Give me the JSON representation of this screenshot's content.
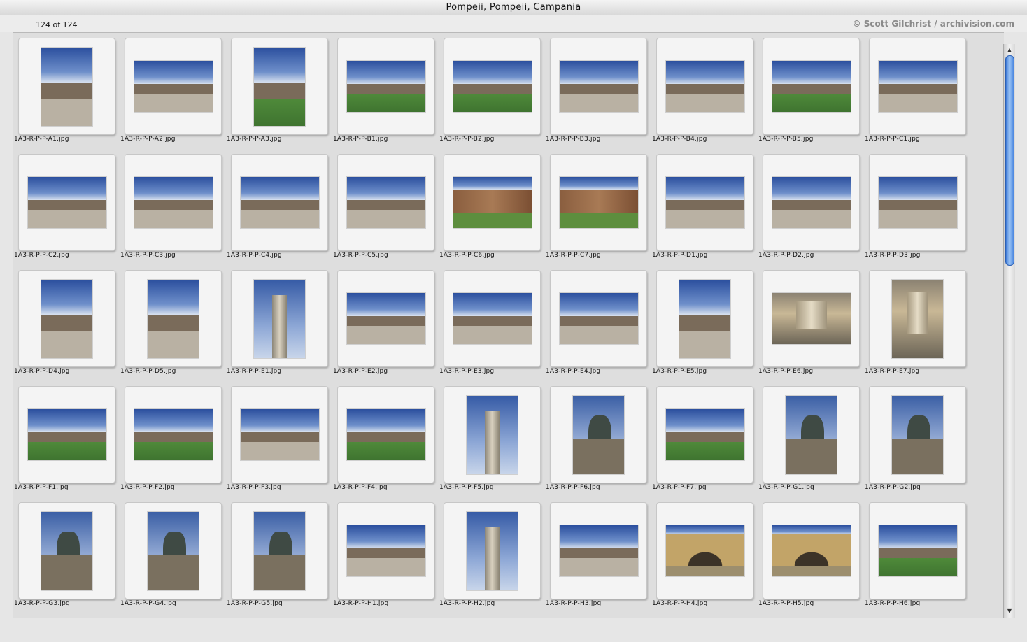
{
  "window": {
    "title": "Pompeii, Pompeii, Campania"
  },
  "info": {
    "count": "124 of 124",
    "copyright": "© Scott Gilchrist / archivision.com"
  },
  "scrollbar": {
    "position_fraction": 0.0,
    "visible_fraction": 0.38
  },
  "thumbnails": [
    {
      "file": "1A3-R-P-P-A1.jpg",
      "orientation": "portrait",
      "style": "plaza"
    },
    {
      "file": "1A3-R-P-P-A2.jpg",
      "orientation": "landscape",
      "style": "plaza"
    },
    {
      "file": "1A3-R-P-P-A3.jpg",
      "orientation": "portrait",
      "style": "grass"
    },
    {
      "file": "1A3-R-P-P-B1.jpg",
      "orientation": "landscape",
      "style": "grass"
    },
    {
      "file": "1A3-R-P-P-B2.jpg",
      "orientation": "landscape",
      "style": "grass"
    },
    {
      "file": "1A3-R-P-P-B3.jpg",
      "orientation": "landscape",
      "style": "plaza"
    },
    {
      "file": "1A3-R-P-P-B4.jpg",
      "orientation": "landscape",
      "style": "plaza"
    },
    {
      "file": "1A3-R-P-P-B5.jpg",
      "orientation": "landscape",
      "style": "grass"
    },
    {
      "file": "1A3-R-P-P-C1.jpg",
      "orientation": "landscape",
      "style": "plaza"
    },
    {
      "file": "1A3-R-P-P-C2.jpg",
      "orientation": "landscape",
      "style": "plaza"
    },
    {
      "file": "1A3-R-P-P-C3.jpg",
      "orientation": "landscape",
      "style": "plaza"
    },
    {
      "file": "1A3-R-P-P-C4.jpg",
      "orientation": "landscape",
      "style": "plaza"
    },
    {
      "file": "1A3-R-P-P-C5.jpg",
      "orientation": "landscape",
      "style": "plaza"
    },
    {
      "file": "1A3-R-P-P-C6.jpg",
      "orientation": "landscape",
      "style": "wall"
    },
    {
      "file": "1A3-R-P-P-C7.jpg",
      "orientation": "landscape",
      "style": "wall"
    },
    {
      "file": "1A3-R-P-P-D1.jpg",
      "orientation": "landscape",
      "style": "plaza"
    },
    {
      "file": "1A3-R-P-P-D2.jpg",
      "orientation": "landscape",
      "style": "plaza"
    },
    {
      "file": "1A3-R-P-P-D3.jpg",
      "orientation": "landscape",
      "style": "plaza"
    },
    {
      "file": "1A3-R-P-P-D4.jpg",
      "orientation": "portrait",
      "style": "plaza"
    },
    {
      "file": "1A3-R-P-P-D5.jpg",
      "orientation": "portrait",
      "style": "plaza"
    },
    {
      "file": "1A3-R-P-P-E1.jpg",
      "orientation": "portrait",
      "style": "column"
    },
    {
      "file": "1A3-R-P-P-E2.jpg",
      "orientation": "landscape",
      "style": "plaza"
    },
    {
      "file": "1A3-R-P-P-E3.jpg",
      "orientation": "landscape",
      "style": "plaza"
    },
    {
      "file": "1A3-R-P-P-E4.jpg",
      "orientation": "landscape",
      "style": "plaza"
    },
    {
      "file": "1A3-R-P-P-E5.jpg",
      "orientation": "portrait",
      "style": "plaza"
    },
    {
      "file": "1A3-R-P-P-E6.jpg",
      "orientation": "landscape",
      "style": "detail"
    },
    {
      "file": "1A3-R-P-P-E7.jpg",
      "orientation": "portrait",
      "style": "detail"
    },
    {
      "file": "1A3-R-P-P-F1.jpg",
      "orientation": "landscape",
      "style": "grass"
    },
    {
      "file": "1A3-R-P-P-F2.jpg",
      "orientation": "landscape",
      "style": "grass"
    },
    {
      "file": "1A3-R-P-P-F3.jpg",
      "orientation": "landscape",
      "style": "plaza"
    },
    {
      "file": "1A3-R-P-P-F4.jpg",
      "orientation": "landscape",
      "style": "grass"
    },
    {
      "file": "1A3-R-P-P-F5.jpg",
      "orientation": "portrait",
      "style": "column"
    },
    {
      "file": "1A3-R-P-P-F6.jpg",
      "orientation": "portrait",
      "style": "statue"
    },
    {
      "file": "1A3-R-P-P-F7.jpg",
      "orientation": "landscape",
      "style": "grass"
    },
    {
      "file": "1A3-R-P-P-G1.jpg",
      "orientation": "portrait",
      "style": "statue"
    },
    {
      "file": "1A3-R-P-P-G2.jpg",
      "orientation": "portrait",
      "style": "statue"
    },
    {
      "file": "1A3-R-P-P-G3.jpg",
      "orientation": "portrait",
      "style": "statue"
    },
    {
      "file": "1A3-R-P-P-G4.jpg",
      "orientation": "portrait",
      "style": "statue"
    },
    {
      "file": "1A3-R-P-P-G5.jpg",
      "orientation": "portrait",
      "style": "statue"
    },
    {
      "file": "1A3-R-P-P-H1.jpg",
      "orientation": "landscape",
      "style": "plaza"
    },
    {
      "file": "1A3-R-P-P-H2.jpg",
      "orientation": "portrait",
      "style": "column"
    },
    {
      "file": "1A3-R-P-P-H3.jpg",
      "orientation": "landscape",
      "style": "plaza"
    },
    {
      "file": "1A3-R-P-P-H4.jpg",
      "orientation": "landscape",
      "style": "arch"
    },
    {
      "file": "1A3-R-P-P-H5.jpg",
      "orientation": "landscape",
      "style": "arch"
    },
    {
      "file": "1A3-R-P-P-H6.jpg",
      "orientation": "landscape",
      "style": "grass"
    }
  ]
}
